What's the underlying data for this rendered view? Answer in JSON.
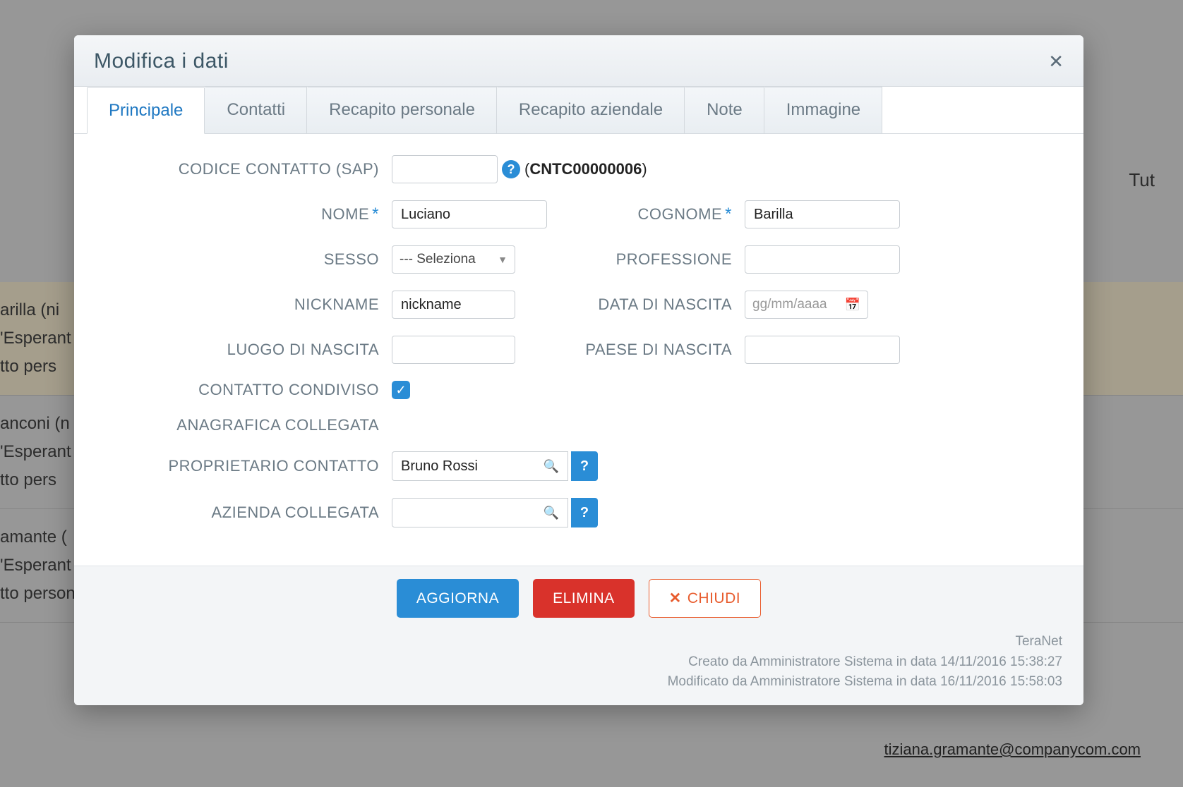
{
  "background": {
    "row1": {
      "line1": "arilla (ni",
      "line2": "'Esperant",
      "line3": "tto pers"
    },
    "row2": {
      "line1": "anconi (n",
      "line2": "'Esperant",
      "line3": "tto pers"
    },
    "row3": {
      "line1": "amante (",
      "line2": "'Esperant",
      "line3": "tto personale condiviso"
    },
    "right_top": "Tut",
    "email": "tiziana.gramante@companycom.com"
  },
  "modal": {
    "title": "Modifica i dati",
    "tabs": [
      "Principale",
      "Contatti",
      "Recapito personale",
      "Recapito aziendale",
      "Note",
      "Immagine"
    ],
    "labels": {
      "codice_contatto": "CODICE CONTATTO (SAP)",
      "sap_code": "CNTC00000006",
      "nome": "NOME",
      "cognome": "COGNOME",
      "sesso": "SESSO",
      "sesso_placeholder": "--- Seleziona",
      "professione": "PROFESSIONE",
      "nickname": "NICKNAME",
      "data_nascita": "DATA DI NASCITA",
      "data_placeholder": "gg/mm/aaaa",
      "luogo_nascita": "LUOGO DI NASCITA",
      "paese_nascita": "PAESE DI NASCITA",
      "contatto_condiviso": "CONTATTO CONDIVISO",
      "anagrafica_collegata": "ANAGRAFICA COLLEGATA",
      "proprietario_contatto": "PROPRIETARIO CONTATTO",
      "azienda_collegata": "AZIENDA COLLEGATA"
    },
    "values": {
      "codice_contatto": "",
      "nome": "Luciano",
      "cognome": "Barilla",
      "professione": "",
      "nickname": "nickname",
      "luogo_nascita": "",
      "paese_nascita": "",
      "contatto_condiviso": true,
      "proprietario_contatto": "Bruno Rossi",
      "azienda_collegata": ""
    },
    "buttons": {
      "aggiorna": "AGGIORNA",
      "elimina": "ELIMINA",
      "chiudi": "CHIUDI"
    },
    "meta": {
      "company": "TeraNet",
      "created": "Creato da Amministratore Sistema in data 14/11/2016 15:38:27",
      "modified": "Modificato da Amministratore Sistema in data 16/11/2016 15:58:03"
    }
  }
}
